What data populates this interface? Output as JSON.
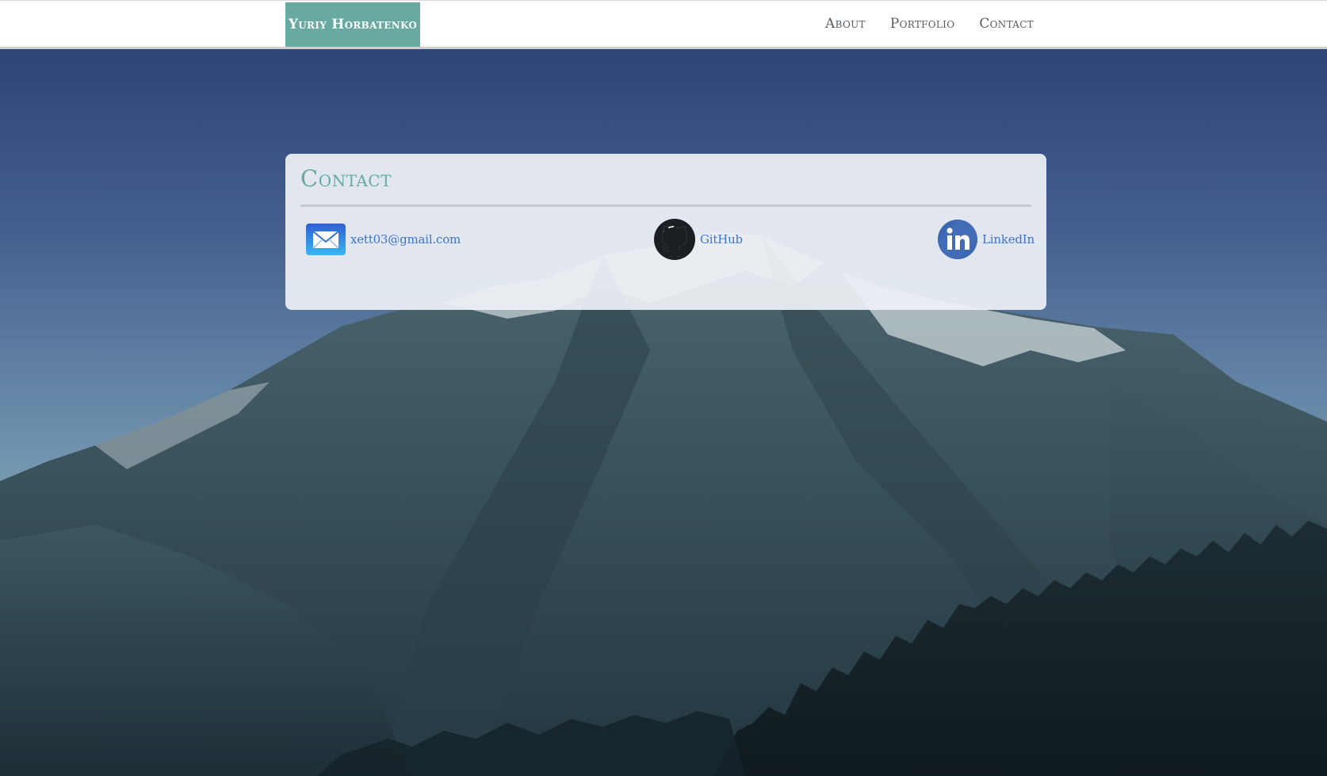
{
  "nav": {
    "brand": "Yuriy Horbatenko",
    "links": [
      {
        "label": "About"
      },
      {
        "label": "Portfolio"
      },
      {
        "label": "Contact"
      }
    ]
  },
  "contact": {
    "title": "Contact",
    "items": [
      {
        "label": "xett03@gmail.com",
        "icon": "envelope-icon"
      },
      {
        "label": "GitHub",
        "icon": "github-icon"
      },
      {
        "label": "LinkedIn",
        "icon": "linkedin-icon"
      }
    ]
  },
  "colors": {
    "brand": "#68aaa1",
    "link": "#3b74d6",
    "nav_text": "#555b63",
    "card_bg": "#eef1f6"
  }
}
